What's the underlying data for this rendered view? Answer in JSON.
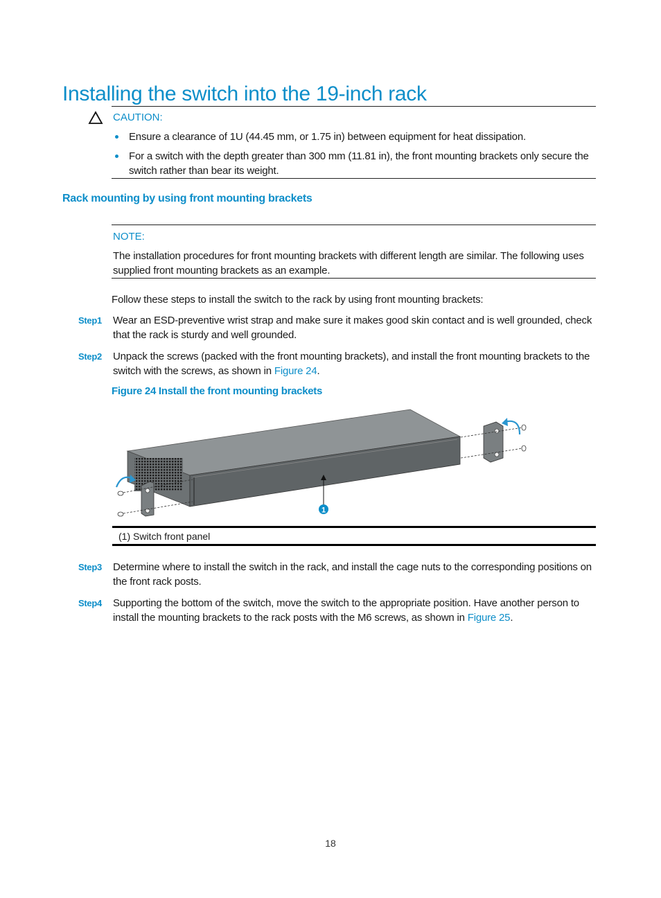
{
  "page": {
    "title": "Installing the switch into the 19-inch rack",
    "page_number": "18"
  },
  "caution": {
    "icon": "warning-triangle-icon",
    "label": "CAUTION:",
    "bullets": [
      "Ensure a clearance of 1U (44.45 mm, or 1.75 in) between equipment for heat dissipation.",
      "For a switch with the depth greater than 300 mm (11.81 in), the front mounting brackets only secure the switch rather than bear its weight."
    ]
  },
  "section": {
    "heading": "Rack mounting by using front mounting brackets",
    "note": {
      "label": "NOTE:",
      "text": "The installation procedures for front mounting brackets with different length are similar. The following uses supplied front mounting brackets as an example."
    },
    "intro": "Follow these steps to install the switch to the rack by using front mounting brackets:",
    "steps": [
      {
        "label": "Step1",
        "text": "Wear an ESD-preventive wrist strap and make sure it makes good skin contact and is well grounded, check that the rack is sturdy and well grounded."
      },
      {
        "label": "Step2",
        "text_before": "Unpack the screws (packed with the front mounting brackets), and install the front mounting brackets to the switch with the screws, as shown in ",
        "link": "Figure 24",
        "text_after": "."
      },
      {
        "label": "Step3",
        "text": "Determine where to install the switch in the rack, and install the cage nuts to the corresponding positions on the front rack posts."
      },
      {
        "label": "Step4",
        "text_before": "Supporting the bottom of the switch, move the switch to the appropriate position. Have another person to install the mounting brackets to the rack posts with the M6 screws, as shown in ",
        "link": "Figure 25",
        "text_after": "."
      }
    ],
    "figure": {
      "caption": "Figure 24 Install the front mounting brackets",
      "callout_number": "1",
      "legend": "(1) Switch front panel"
    }
  },
  "colors": {
    "accent": "#0d8ec9",
    "switch_top": "#8f9496",
    "switch_front": "#5f6466",
    "switch_side": "#6d7274"
  }
}
